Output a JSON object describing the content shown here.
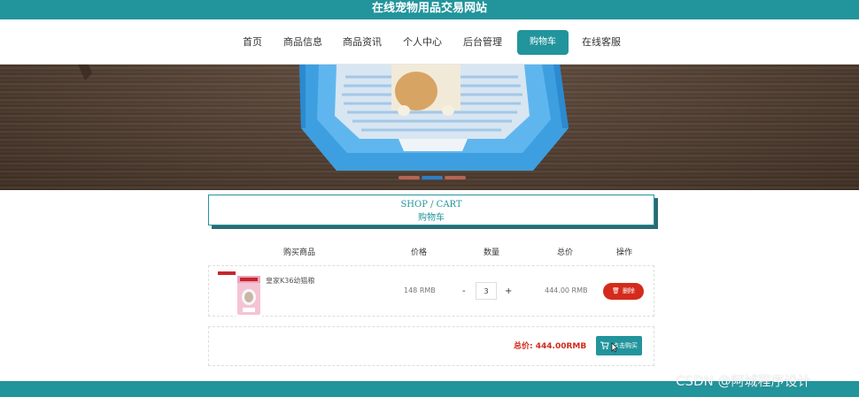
{
  "site": {
    "title": "在线宠物用品交易网站"
  },
  "nav": {
    "items": [
      {
        "label": "首页"
      },
      {
        "label": "商品信息"
      },
      {
        "label": "商品资讯"
      },
      {
        "label": "个人中心"
      },
      {
        "label": "后台管理"
      },
      {
        "label": "购物车"
      },
      {
        "label": "在线客服"
      }
    ],
    "active": "购物车"
  },
  "section": {
    "title_en": "SHOP / CART",
    "title_cn": "购物车"
  },
  "cart": {
    "headers": [
      "购买商品",
      "价格",
      "数量",
      "总价",
      "操作"
    ],
    "items": [
      {
        "name": "皇家K36幼猫粮",
        "price": "148 RMB",
        "quantity": "3",
        "total": "444.00 RMB",
        "delete_label": "删除",
        "minus": "-",
        "plus": "+"
      }
    ],
    "total_label": "总价: 444.00RMB",
    "buy_label": "点击购买"
  },
  "watermark": "CSDN @阿城程序设计",
  "colors": {
    "primary": "#22949c",
    "danger": "#d42a1c"
  }
}
